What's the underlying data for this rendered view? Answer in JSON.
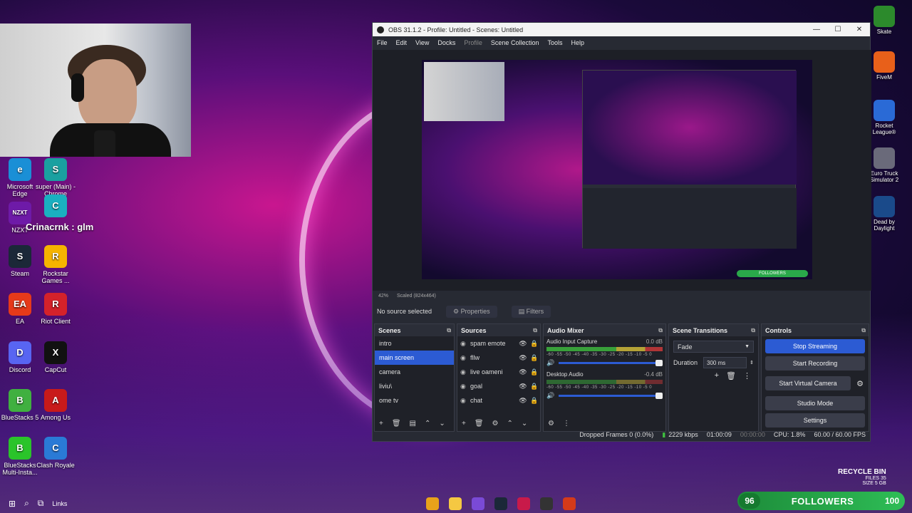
{
  "desktop": {
    "icons_left": [
      {
        "label": "Microsoft Edge",
        "color": "#1a8fd6",
        "glyph": "e"
      },
      {
        "label": "super (Main) - Chrome",
        "color": "#1aa0a0",
        "glyph": "S"
      },
      {
        "label": "NZXT",
        "color": "#6e1aa8",
        "glyph": "NZXT"
      },
      {
        "label": "",
        "color": "#1ab0c0",
        "glyph": "C"
      },
      {
        "label": "Steam",
        "color": "#1b2838",
        "glyph": "S"
      },
      {
        "label": "Rockstar Games ...",
        "color": "#f5b400",
        "glyph": "R"
      },
      {
        "label": "EA",
        "color": "#e63a1a",
        "glyph": "EA"
      },
      {
        "label": "Riot Client",
        "color": "#d4222a",
        "glyph": "R"
      },
      {
        "label": "Discord",
        "color": "#5865f2",
        "glyph": "D"
      },
      {
        "label": "CapCut",
        "color": "#111111",
        "glyph": "X"
      },
      {
        "label": "BlueStacks 5",
        "color": "#40b040",
        "glyph": "B"
      },
      {
        "label": "Among Us",
        "color": "#c81a1a",
        "glyph": "A"
      },
      {
        "label": "BlueStacks Multi-Insta...",
        "color": "#2ac42a",
        "glyph": "B"
      },
      {
        "label": "Clash Royale",
        "color": "#2a7ad6",
        "glyph": "C"
      }
    ],
    "overlay_text": "Crinacrnk : glm",
    "icons_right": [
      {
        "label": "Skate",
        "color": "#2c8a2c"
      },
      {
        "label": "FiveM",
        "color": "#e8601a"
      },
      {
        "label": "Rocket League®",
        "color": "#2a6ad6"
      },
      {
        "label": "Euro Truck Simulator 2",
        "color": "#6a6a7a"
      },
      {
        "label": "Dead by Daylight",
        "color": "#1a4a8a"
      }
    ],
    "recycle_bin": {
      "title": "RECYCLE BIN",
      "files": "FILES 35",
      "size": "SIZE 5 GB"
    },
    "followers": {
      "current": "96",
      "label": "FOLLOWERS",
      "goal": "100"
    },
    "taskbar": {
      "links": "Links"
    }
  },
  "obs": {
    "title": "OBS 31.1.2 - Profile: Untitled - Scenes: Untitled",
    "menu": [
      "File",
      "Edit",
      "View",
      "Docks",
      "Profile",
      "Scene Collection",
      "Tools",
      "Help"
    ],
    "preview_status": {
      "zoom": "42%",
      "scaled": "Scaled (824x464)"
    },
    "no_source": "No source selected",
    "properties": "Properties",
    "filters": "Filters",
    "scenes": {
      "title": "Scenes",
      "items": [
        "intro",
        "main screen",
        "camera",
        "liviu\\",
        "ome tv"
      ],
      "selected_index": 1
    },
    "sources": {
      "title": "Sources",
      "items": [
        "spam emote",
        "fllw",
        "live oameni",
        "goal",
        "chat"
      ]
    },
    "mixer": {
      "title": "Audio Mixer",
      "channels": [
        {
          "name": "Audio Input Capture",
          "db": "0.0 dB"
        },
        {
          "name": "Desktop Audio",
          "db": "-0.4 dB"
        }
      ],
      "scale": "-60 -55 -50 -45 -40 -35 -30 -25 -20 -15 -10 -5 0"
    },
    "transitions": {
      "title": "Scene Transitions",
      "selected": "Fade",
      "duration_label": "Duration",
      "duration_value": "300 ms"
    },
    "controls": {
      "title": "Controls",
      "stop_streaming": "Stop Streaming",
      "start_recording": "Start Recording",
      "virtual_camera": "Start Virtual Camera",
      "studio_mode": "Studio Mode",
      "settings": "Settings"
    },
    "statusbar": {
      "dropped": "Dropped Frames 0 (0.0%)",
      "bitrate": "2229 kbps",
      "stream_time": "01:00:09",
      "rec_time": "00:00:00",
      "cpu": "CPU: 1.8%",
      "fps": "60.00 / 60.00 FPS"
    }
  }
}
